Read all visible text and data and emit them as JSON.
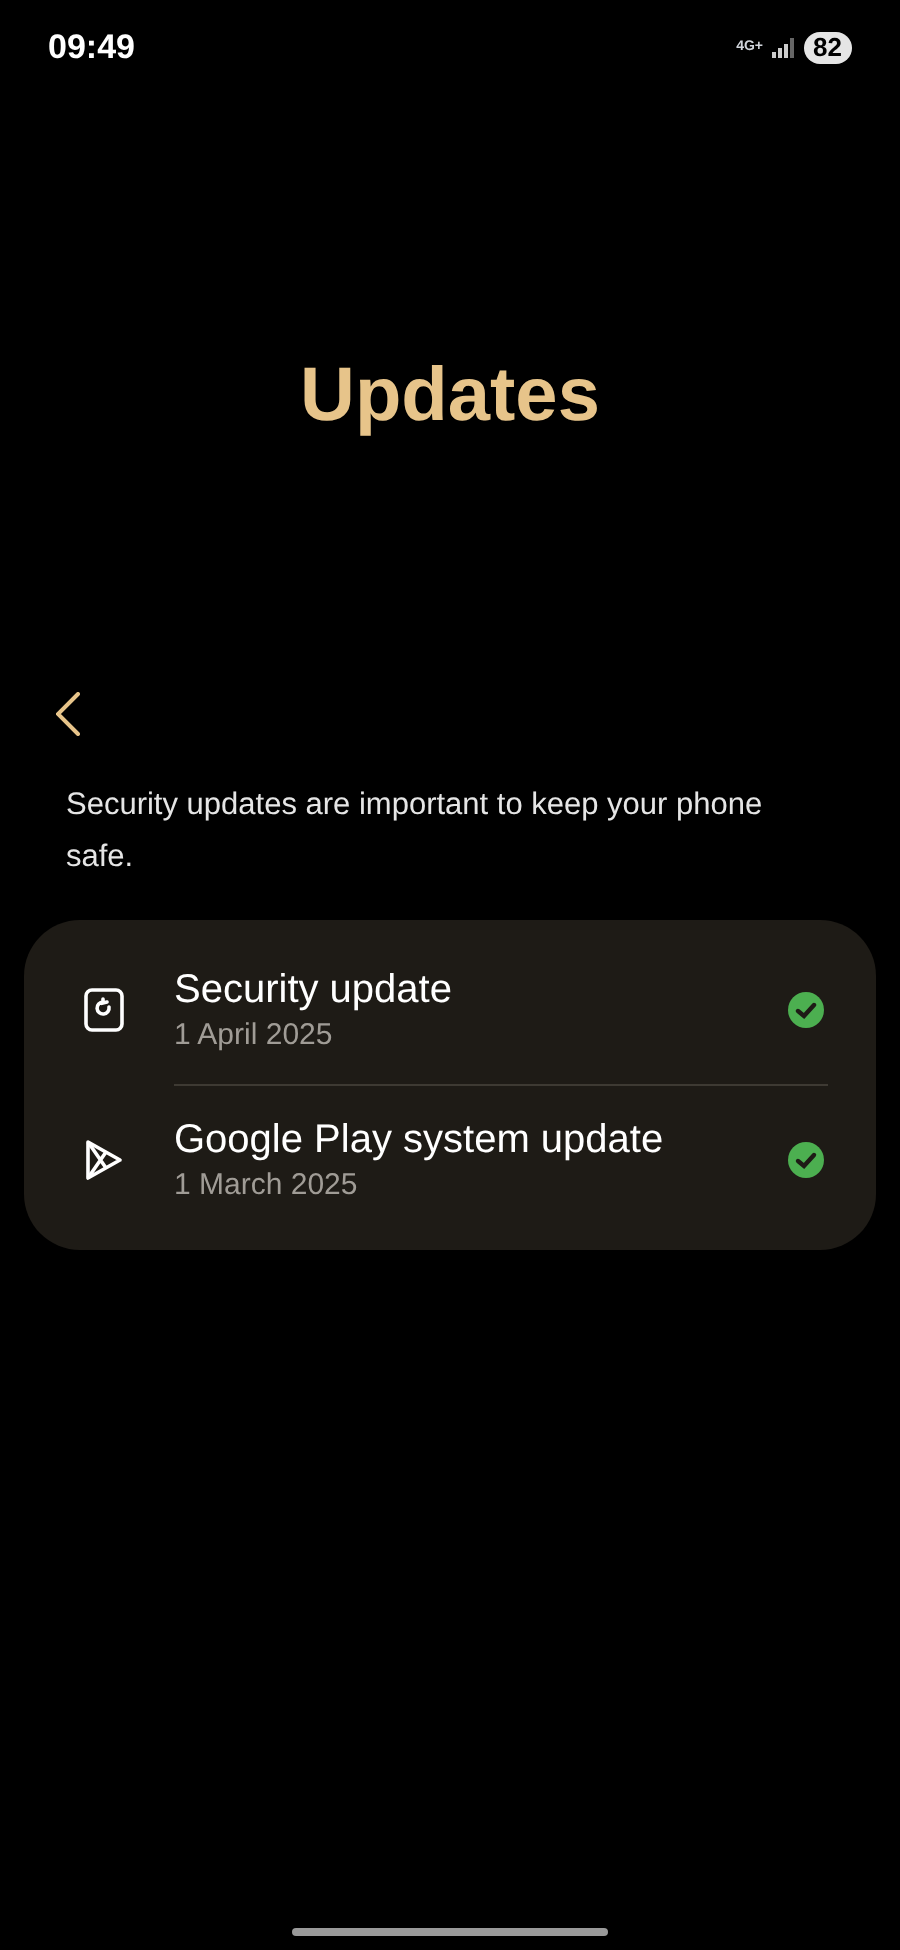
{
  "status_bar": {
    "time": "09:49",
    "network": "4G+",
    "battery": "82"
  },
  "title": "Updates",
  "description": "Security updates are important to keep your phone safe.",
  "items": [
    {
      "kind": "security",
      "title": "Security update",
      "date": "1 April 2025",
      "up_to_date": true
    },
    {
      "kind": "play",
      "title": "Google Play system update",
      "date": "1 March 2025",
      "up_to_date": true
    }
  ]
}
